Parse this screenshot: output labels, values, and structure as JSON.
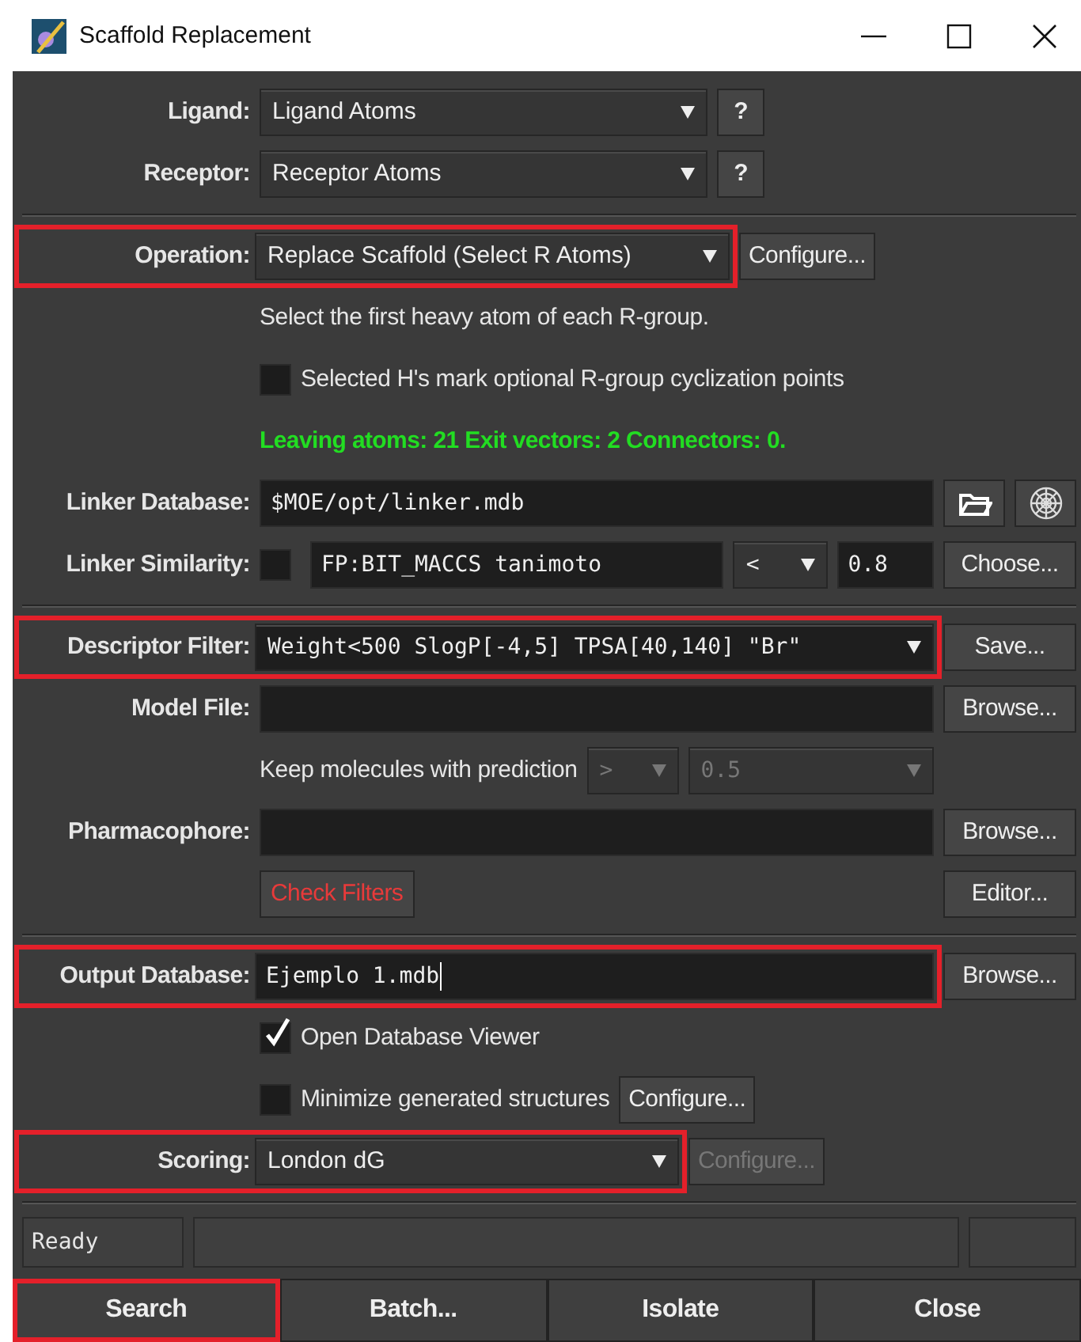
{
  "window": {
    "title": "Scaffold Replacement"
  },
  "ligand": {
    "label": "Ligand:",
    "value": "Ligand Atoms",
    "help": "?"
  },
  "receptor": {
    "label": "Receptor:",
    "value": "Receptor Atoms",
    "help": "?"
  },
  "operation": {
    "label": "Operation:",
    "value": "Replace Scaffold (Select R Atoms)",
    "highlighted": true,
    "button": "Configure..."
  },
  "hint": "Select the first heavy atom of each R-group.",
  "cyclization": {
    "label": "Selected H's mark optional R-group cyclization points",
    "checked": false
  },
  "status_message": "Leaving atoms: 21  Exit vectors: 2  Connectors: 0.",
  "linker_database": {
    "label": "Linker Database:",
    "value": "$MOE/opt/linker.mdb"
  },
  "linker_similarity": {
    "label": "Linker Similarity:",
    "checked": false,
    "fingerprint": "FP:BIT_MACCS tanimoto",
    "operator": "<",
    "threshold": "0.8",
    "button": "Choose..."
  },
  "descriptor_filter": {
    "label": "Descriptor Filter:",
    "value": "Weight<500 SlogP[-4,5] TPSA[40,140] \"Br\"",
    "highlighted": true,
    "button": "Save..."
  },
  "model_file": {
    "label": "Model File:",
    "button": "Browse..."
  },
  "prediction": {
    "label": "Keep molecules with prediction",
    "operator": ">",
    "threshold": "0.5",
    "disabled": true
  },
  "pharmacophore": {
    "label": "Pharmacophore:",
    "button": "Browse..."
  },
  "check_filters": "Check Filters",
  "editor_button": "Editor...",
  "output_database": {
    "label": "Output Database:",
    "value": "Ejemplo 1.mdb",
    "highlighted": true,
    "button": "Browse..."
  },
  "open_viewer": {
    "label": "Open Database Viewer",
    "checked": true
  },
  "minimize": {
    "label": "Minimize generated structures",
    "checked": false,
    "button": "Configure..."
  },
  "scoring": {
    "label": "Scoring:",
    "value": "London dG",
    "highlighted": true,
    "button": "Configure...",
    "button_disabled": true
  },
  "status_bar": {
    "text": "Ready"
  },
  "buttons": [
    {
      "label": "Search",
      "highlighted": true
    },
    {
      "label": "Batch...",
      "highlighted": false
    },
    {
      "label": "Isolate",
      "highlighted": false
    },
    {
      "label": "Close",
      "highlighted": false
    }
  ]
}
